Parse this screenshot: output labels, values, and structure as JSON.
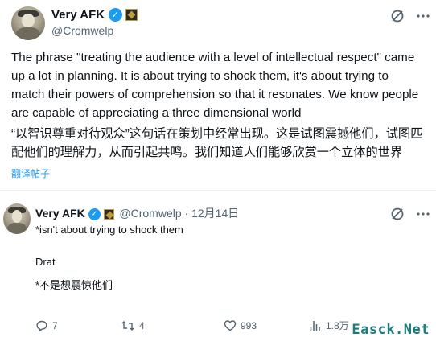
{
  "tweet": {
    "author_name": "Very AFK",
    "author_handle": "@Cromwelp",
    "text": "The phrase \"treating the audience with a level of intellectual respect\" came up a lot in planning. It is about trying to shock them, it's about trying to match their powers of comprehension so that it resonates. We know people are capable of appreciating a three dimensional world",
    "translated_text": "“以智识尊重对待观众”这句话在策划中经常出现。这是试图震撼他们，试图匹配他们的理解力，从而引起共鸣。我们知道人们能够欣赏一个立体的世界",
    "translate_label": "翻译帖子"
  },
  "reply": {
    "author_name": "Very AFK",
    "author_handle": "@Cromwelp",
    "dot": "·",
    "date": "12月14日",
    "line1": "*isn't about trying to shock them",
    "line2": "Drat",
    "line3": "*不是想震惊他们",
    "actions": {
      "replies": "7",
      "reposts": "4",
      "likes": "993",
      "views": "1.8万"
    }
  },
  "watermark": "Easck.Net",
  "colors": {
    "accent": "#1d9bf0",
    "text": "#0f1419",
    "muted": "#536471"
  }
}
